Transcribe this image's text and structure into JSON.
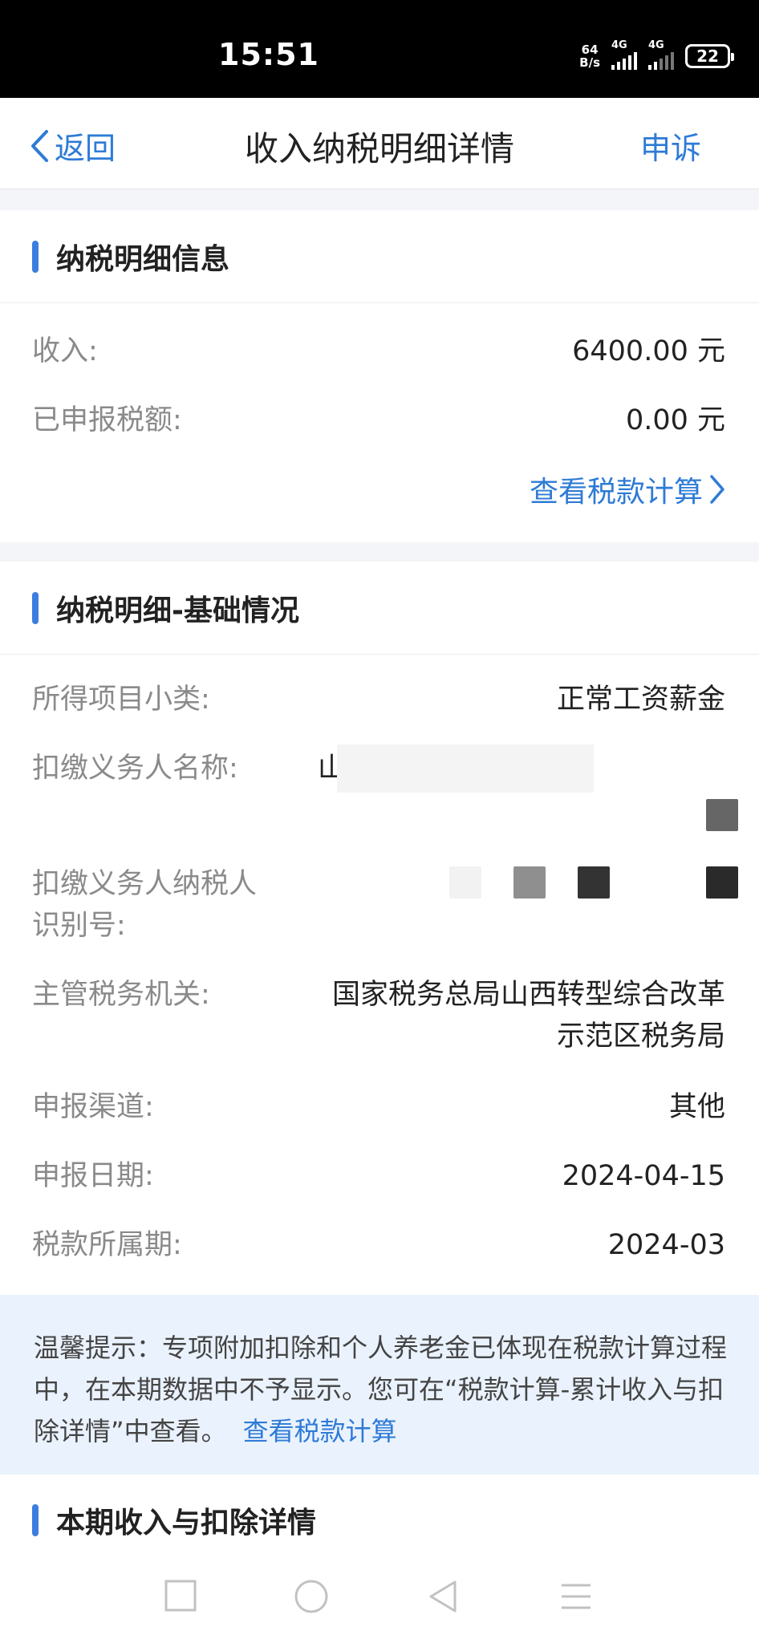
{
  "status_bar": {
    "time": "15:51",
    "net_speed_value": "64",
    "net_speed_unit": "B/s",
    "signal1_label": "4G",
    "signal2_label": "4G",
    "battery": "22"
  },
  "nav": {
    "back_label": "返回",
    "title": "收入纳税明细详情",
    "appeal_label": "申诉"
  },
  "tax_info": {
    "section_title": "纳税明细信息",
    "income_label": "收入:",
    "income_value": "6400.00 元",
    "declared_tax_label": "已申报税额:",
    "declared_tax_value": "0.00 元",
    "view_calc_link": "查看税款计算"
  },
  "basic_info": {
    "section_title": "纳税明细-基础情况",
    "item_subtype_label": "所得项目小类:",
    "item_subtype_value": "正常工资薪金",
    "withholder_name_label": "扣缴义务人名称:",
    "withholder_name_value": "山西",
    "withholder_taxid_label": "扣缴义务人纳税人识别号:",
    "tax_authority_label": "主管税务机关:",
    "tax_authority_value": "国家税务总局山西转型综合改革示范区税务局",
    "channel_label": "申报渠道:",
    "channel_value": "其他",
    "declare_date_label": "申报日期:",
    "declare_date_value": "2024-04-15",
    "tax_period_label": "税款所属期:",
    "tax_period_value": "2024-03"
  },
  "notice": {
    "text": "温馨提示：专项附加扣除和个人养老金已体现在税款计算过程中，在本期数据中不予显示。您可在“税款计算-累计收入与扣除详情”中查看。",
    "link": "查看税款计算"
  },
  "income_deduction": {
    "section_title": "本期收入与扣除详情"
  },
  "colors": {
    "accent": "#3c7ee0",
    "link": "#2e7bd6",
    "notice_bg": "#eaf2fd"
  }
}
